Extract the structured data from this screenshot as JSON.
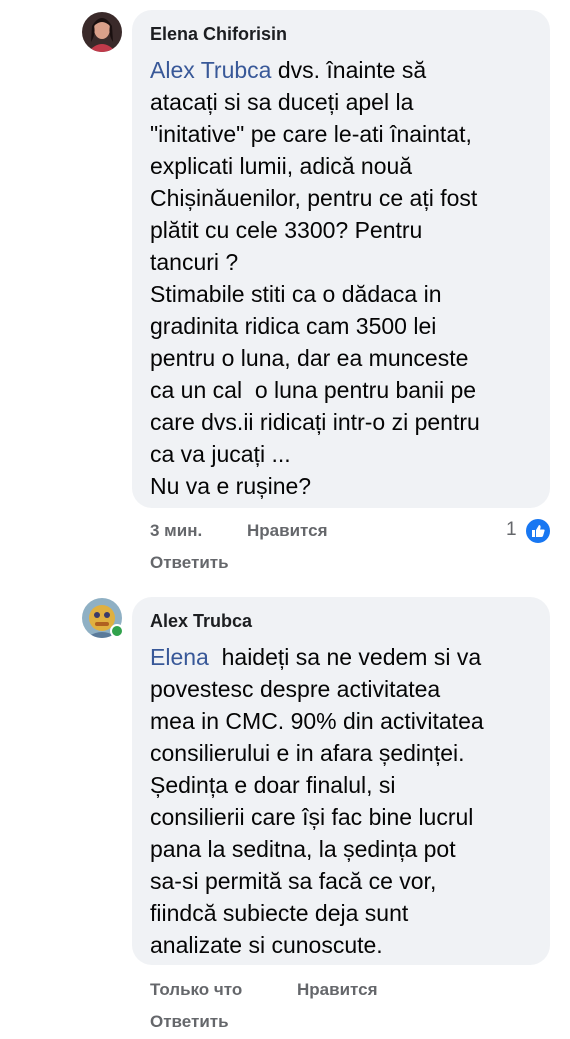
{
  "comments": [
    {
      "author": "Elena Chiforisin",
      "mention": "Alex Trubca",
      "text": " dvs. înainte să\natacați si sa duceți apel la\n\"initative\" pe care le-ati înaintat,\nexplicati lumii, adică nouă\nChișinăuenilor, pentru ce ați fost\nplătit cu cele 3300? Pentru\ntancuri ?\nStimabile stiti ca o dădaca in\ngradinita ridica cam 3500 lei\npentru o luna, dar ea munceste\nca un cal  o luna pentru banii pe\ncare dvs.ii ridicați intr-o zi pentru\nca va jucați ...\nNu va e rușine?",
      "time": "3 мин.",
      "like_label": "Нравится",
      "reply_label": "Ответить",
      "reaction_count": "1",
      "reaction_icon": "like-icon"
    },
    {
      "author": "Alex Trubca",
      "mention": "Elena",
      "text": "  haideți sa ne vedem si va\npovestesc despre activitatea\nmea in CMC. 90% din activitatea\nconsilierului e in afara ședinței.\nȘedința e doar finalul, si\nconsilierii care își fac bine lucrul\npana la seditna, la ședința pot\nsa-si permită sa facă ce vor,\nfiindcă subiecte deja sunt\nanalizate si cunoscute.",
      "time": "Только что",
      "like_label": "Нравится",
      "reply_label": "Ответить",
      "online": true
    }
  ],
  "colors": {
    "bubble": "#f0f2f5",
    "mention": "#385898",
    "meta": "#65676b",
    "like": "#1877f2",
    "online": "#31a24c"
  }
}
